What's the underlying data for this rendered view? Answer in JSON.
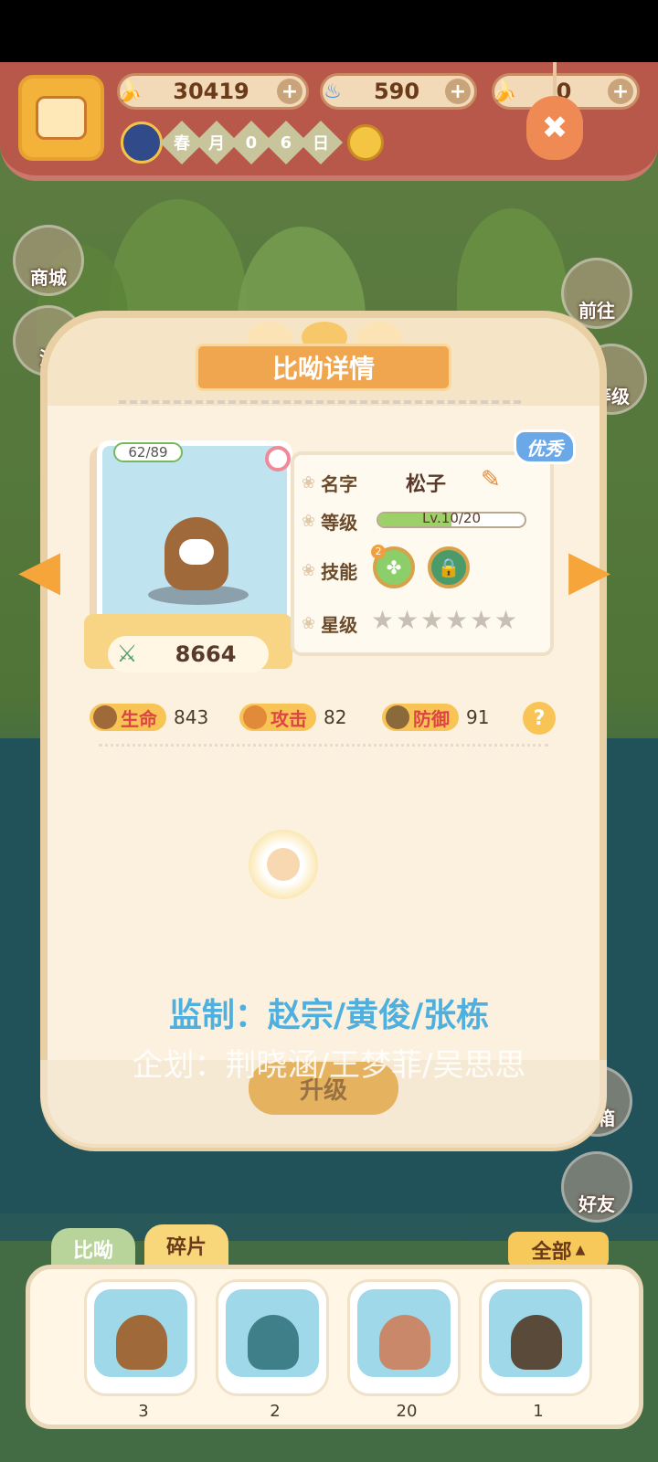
{
  "topbar": {
    "resources": [
      {
        "icon": "banana-icon",
        "value": "30419"
      },
      {
        "icon": "flame-icon",
        "value": "590"
      },
      {
        "icon": "blue-banana-icon",
        "value": "0"
      }
    ],
    "date": {
      "chars": [
        "春",
        "月",
        "0",
        "6",
        "日"
      ]
    }
  },
  "side_menu": {
    "left": [
      "商城",
      "活"
    ],
    "right": [
      "前往",
      "等级",
      "邮箱",
      "好友"
    ]
  },
  "panel": {
    "title": "比呦详情",
    "card": {
      "hp": "62/89",
      "power": "8664"
    },
    "badge": "优秀",
    "info": {
      "name_label": "名字",
      "name": "松子",
      "level_label": "等级",
      "level_text": "Lv.10/20",
      "level_progress": 0.5,
      "skill_label": "技能",
      "skill_level_badge": "2",
      "star_label": "星级",
      "stars_filled": 0,
      "stars_total": 6
    },
    "stats": [
      {
        "label": "生命",
        "value": "843"
      },
      {
        "label": "攻击",
        "value": "82"
      },
      {
        "label": "防御",
        "value": "91"
      }
    ],
    "help": "?",
    "upgrade": "升级"
  },
  "credits": {
    "line1": "监制：赵宗/黄俊/张栋",
    "line2": "企划：荆晓涵/王梦菲/吴思思"
  },
  "bottom": {
    "tabs": [
      "比呦",
      "碎片"
    ],
    "filter": "全部",
    "items": [
      {
        "count": "3",
        "color": "#a0693a"
      },
      {
        "count": "2",
        "color": "#3f7f8a"
      },
      {
        "count": "20",
        "color": "#c9886a"
      },
      {
        "count": "1",
        "color": "#5a4a3a"
      }
    ]
  }
}
